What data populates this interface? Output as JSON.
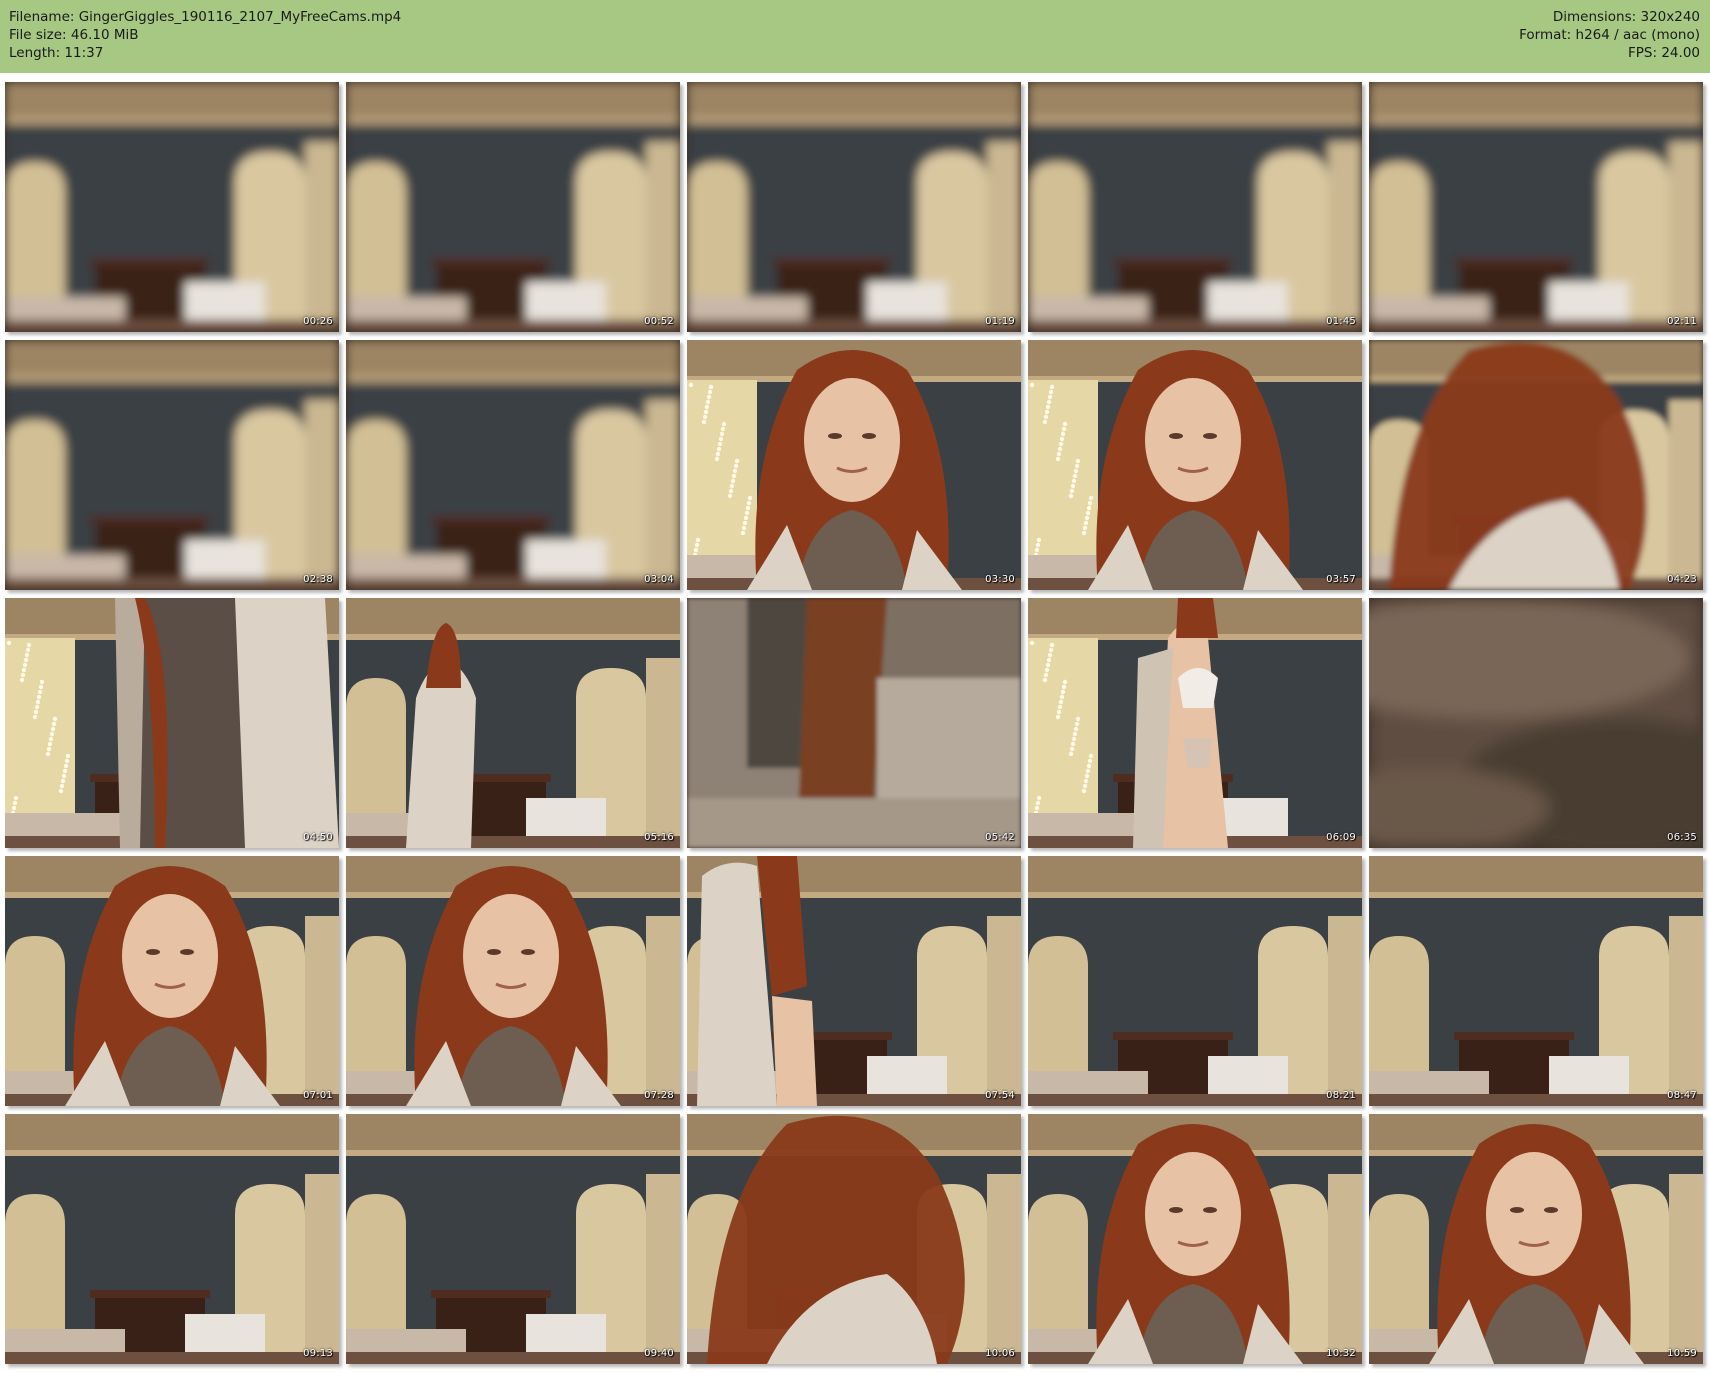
{
  "header": {
    "left": [
      "Filename: GingerGiggles_190116_2107_MyFreeCams.mp4",
      "File size: 46.10 MiB",
      "Length: 11:37"
    ],
    "right": [
      "Dimensions: 320x240",
      "Format: h264 / aac (mono)",
      "FPS: 24.00"
    ],
    "bar_color": "#a6c882"
  },
  "thumbnails": [
    {
      "time": "00:26",
      "scene": "blurry-room"
    },
    {
      "time": "00:52",
      "scene": "blurry-room"
    },
    {
      "time": "01:19",
      "scene": "blurry-room"
    },
    {
      "time": "01:45",
      "scene": "blurry-room"
    },
    {
      "time": "02:11",
      "scene": "blurry-room"
    },
    {
      "time": "02:38",
      "scene": "blurry-room"
    },
    {
      "time": "03:04",
      "scene": "blurry-room"
    },
    {
      "time": "03:30",
      "scene": "woman-closeup-lights"
    },
    {
      "time": "03:57",
      "scene": "woman-closeup-lights"
    },
    {
      "time": "04:23",
      "scene": "hair-motion-blur"
    },
    {
      "time": "04:50",
      "scene": "cardigan-closeup-lights"
    },
    {
      "time": "05:16",
      "scene": "woman-walking-room"
    },
    {
      "time": "05:42",
      "scene": "cardigan-texture"
    },
    {
      "time": "06:09",
      "scene": "woman-standing-lights"
    },
    {
      "time": "06:35",
      "scene": "fabric-closeup"
    },
    {
      "time": "07:01",
      "scene": "woman-closeup-room"
    },
    {
      "time": "07:28",
      "scene": "woman-closeup-room"
    },
    {
      "time": "07:54",
      "scene": "woman-side-room"
    },
    {
      "time": "08:21",
      "scene": "empty-room"
    },
    {
      "time": "08:47",
      "scene": "empty-room"
    },
    {
      "time": "09:13",
      "scene": "empty-room"
    },
    {
      "time": "09:40",
      "scene": "empty-room"
    },
    {
      "time": "10:06",
      "scene": "hair-motion-room"
    },
    {
      "time": "10:32",
      "scene": "woman-closeup-room"
    },
    {
      "time": "10:59",
      "scene": "woman-closeup-room"
    }
  ]
}
